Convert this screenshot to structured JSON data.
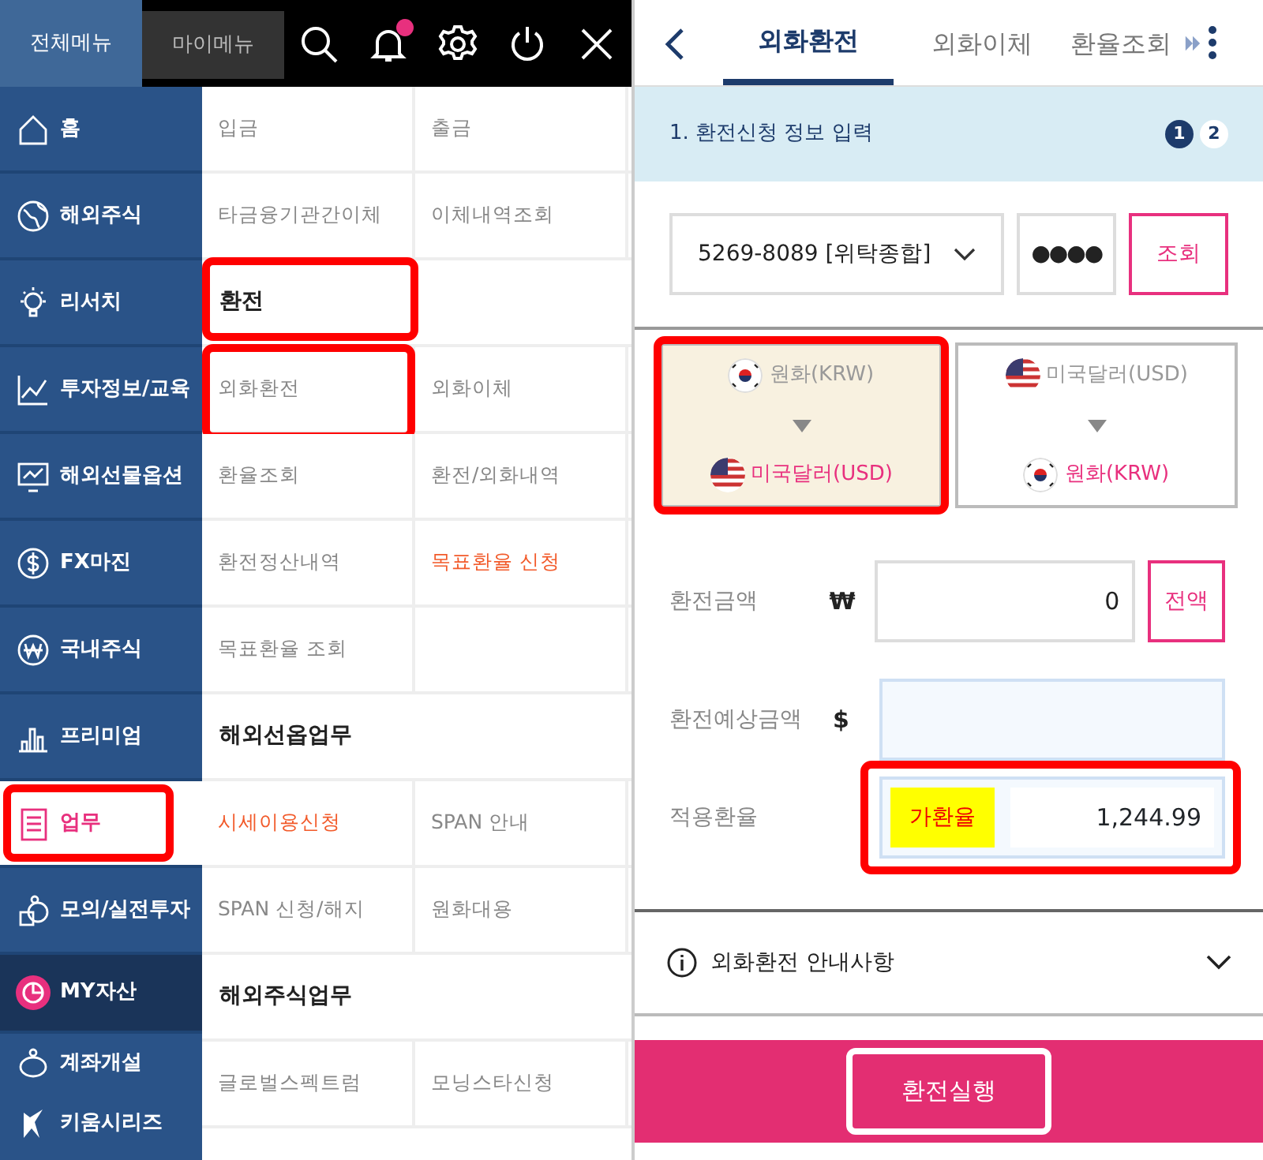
{
  "left_screen": {
    "top_tabs": [
      {
        "label": "전체메뉴",
        "selected": true
      },
      {
        "label": "마이메뉴",
        "selected": false
      }
    ],
    "notification_dot": true,
    "sidebar": {
      "items": [
        {
          "label": "홈",
          "kind": "home",
          "selected": false,
          "highlighted": false
        },
        {
          "label": "해외주식",
          "kind": "globe",
          "selected": false,
          "highlighted": false
        },
        {
          "label": "리서치",
          "kind": "bulb",
          "selected": false,
          "highlighted": false
        },
        {
          "label": "투자정보/교육",
          "kind": "chart",
          "selected": false,
          "highlighted": false
        },
        {
          "label": "해외선물옵션",
          "kind": "monitor",
          "selected": false,
          "highlighted": false
        },
        {
          "label": "FX마진",
          "kind": "dollar",
          "selected": false,
          "highlighted": false
        },
        {
          "label": "국내주식",
          "kind": "won",
          "selected": false,
          "highlighted": false
        },
        {
          "label": "프리미엄",
          "kind": "bars",
          "selected": false,
          "highlighted": false
        },
        {
          "label": "업무",
          "kind": "checklist",
          "selected": true,
          "highlighted": true
        },
        {
          "label": "모의/실전투자",
          "kind": "coins",
          "selected": false,
          "highlighted": false
        },
        {
          "label": "MY자산",
          "kind": "assets",
          "selected": false,
          "highlighted": false
        },
        {
          "label": "계좌개설",
          "kind": "piggy",
          "selected": false,
          "highlighted": false
        },
        {
          "label": "키움시리즈",
          "kind": "brand",
          "selected": false,
          "highlighted": false
        }
      ]
    },
    "menu": {
      "rows": [
        {
          "kind": "links",
          "cells": [
            {
              "label": "입금",
              "accent": false,
              "highlighted": false
            },
            {
              "label": "출금",
              "accent": false,
              "highlighted": false
            }
          ]
        },
        {
          "kind": "links",
          "cells": [
            {
              "label": "타금융기관간이체",
              "accent": false,
              "highlighted": false
            },
            {
              "label": "이체내역조회",
              "accent": false,
              "highlighted": false
            }
          ]
        },
        {
          "kind": "header",
          "label": "환전",
          "highlighted": true
        },
        {
          "kind": "links",
          "cells": [
            {
              "label": "외화환전",
              "accent": false,
              "highlighted": true
            },
            {
              "label": "외화이체",
              "accent": false,
              "highlighted": false
            }
          ]
        },
        {
          "kind": "links",
          "cells": [
            {
              "label": "환율조회",
              "accent": false,
              "highlighted": false
            },
            {
              "label": "환전/외화내역",
              "accent": false,
              "highlighted": false
            }
          ]
        },
        {
          "kind": "links",
          "cells": [
            {
              "label": "환전정산내역",
              "accent": false,
              "highlighted": false
            },
            {
              "label": "목표환율 신청",
              "accent": true,
              "highlighted": false
            }
          ]
        },
        {
          "kind": "links",
          "cells": [
            {
              "label": "목표환율 조회",
              "accent": false,
              "highlighted": false
            }
          ]
        },
        {
          "kind": "header",
          "label": "해외선옵업무",
          "highlighted": false
        },
        {
          "kind": "links",
          "cells": [
            {
              "label": "시세이용신청",
              "accent": true,
              "highlighted": false
            },
            {
              "label": "SPAN 안내",
              "accent": false,
              "highlighted": false
            }
          ]
        },
        {
          "kind": "links",
          "cells": [
            {
              "label": "SPAN 신청/해지",
              "accent": false,
              "highlighted": false
            },
            {
              "label": "원화대용",
              "accent": false,
              "highlighted": false
            }
          ]
        },
        {
          "kind": "header",
          "label": "해외주식업무",
          "highlighted": false
        },
        {
          "kind": "links",
          "cells": [
            {
              "label": "글로벌스펙트럼",
              "accent": false,
              "highlighted": false
            },
            {
              "label": "모닝스타신청",
              "accent": false,
              "highlighted": false
            }
          ]
        }
      ]
    }
  },
  "right_screen": {
    "tabs": [
      {
        "label": "외화환전",
        "selected": true
      },
      {
        "label": "외화이체",
        "selected": false
      },
      {
        "label": "환율조회",
        "selected": false
      }
    ],
    "step": {
      "title": "1. 환전신청 정보 입력",
      "steps": [
        {
          "label": "1",
          "selected": true
        },
        {
          "label": "2",
          "selected": false
        }
      ]
    },
    "account": {
      "value": "5269-8089 [위탁종합]",
      "password": "●●●●",
      "button": "조회"
    },
    "directions": [
      {
        "from": {
          "label": "원화(KRW)",
          "kind": "kr"
        },
        "to": {
          "label": "미국달러(USD)",
          "kind": "us"
        },
        "selected": true,
        "highlighted": true
      },
      {
        "from": {
          "label": "미국달러(USD)",
          "kind": "us"
        },
        "to": {
          "label": "원화(KRW)",
          "kind": "kr"
        },
        "selected": false,
        "highlighted": false
      }
    ],
    "amount": {
      "label": "환전금액",
      "currency": "₩",
      "value": "0",
      "button": "전액"
    },
    "expected": {
      "label": "환전예상금액",
      "currency": "$"
    },
    "rate": {
      "label": "적용환율",
      "badge": "가환율",
      "value": "1,244.99",
      "highlighted": true
    },
    "notice": {
      "label": "외화환전 안내사항",
      "expanded": false
    },
    "submit": {
      "label": "환전실행",
      "highlighted": true
    }
  }
}
